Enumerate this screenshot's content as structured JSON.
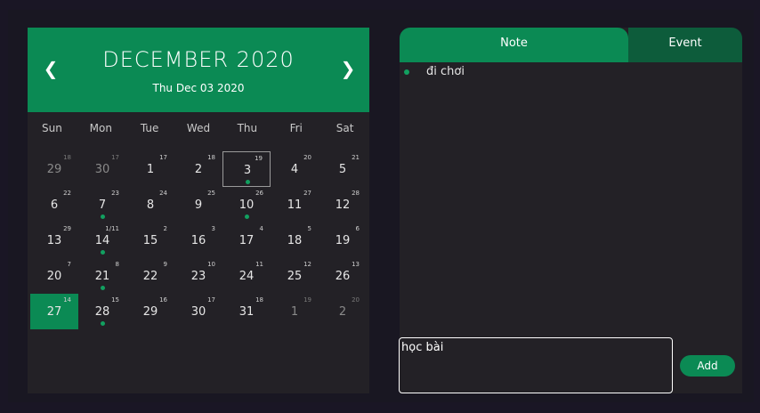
{
  "calendar": {
    "title": "DECEMBER 2020",
    "selected_date_label": "Thu Dec 03 2020",
    "prev_icon": "chevron-left",
    "next_icon": "chevron-right",
    "weekdays": [
      "Sun",
      "Mon",
      "Tue",
      "Wed",
      "Thu",
      "Fri",
      "Sat"
    ],
    "days": [
      {
        "day": "29",
        "lunar": "18",
        "other": true
      },
      {
        "day": "30",
        "lunar": "17",
        "other": true
      },
      {
        "day": "1",
        "lunar": "17"
      },
      {
        "day": "2",
        "lunar": "18"
      },
      {
        "day": "3",
        "lunar": "19",
        "dot": true,
        "selected": true
      },
      {
        "day": "4",
        "lunar": "20"
      },
      {
        "day": "5",
        "lunar": "21"
      },
      {
        "day": "6",
        "lunar": "22"
      },
      {
        "day": "7",
        "lunar": "23",
        "dot": true
      },
      {
        "day": "8",
        "lunar": "24"
      },
      {
        "day": "9",
        "lunar": "25"
      },
      {
        "day": "10",
        "lunar": "26",
        "dot": true
      },
      {
        "day": "11",
        "lunar": "27"
      },
      {
        "day": "12",
        "lunar": "28"
      },
      {
        "day": "13",
        "lunar": "29"
      },
      {
        "day": "14",
        "lunar": "1/11",
        "dot": true
      },
      {
        "day": "15",
        "lunar": "2"
      },
      {
        "day": "16",
        "lunar": "3"
      },
      {
        "day": "17",
        "lunar": "4"
      },
      {
        "day": "18",
        "lunar": "5"
      },
      {
        "day": "19",
        "lunar": "6"
      },
      {
        "day": "20",
        "lunar": "7"
      },
      {
        "day": "21",
        "lunar": "8",
        "dot": true
      },
      {
        "day": "22",
        "lunar": "9"
      },
      {
        "day": "23",
        "lunar": "10"
      },
      {
        "day": "24",
        "lunar": "11"
      },
      {
        "day": "25",
        "lunar": "12"
      },
      {
        "day": "26",
        "lunar": "13"
      },
      {
        "day": "27",
        "lunar": "14",
        "today": true
      },
      {
        "day": "28",
        "lunar": "15",
        "dot": true
      },
      {
        "day": "29",
        "lunar": "16"
      },
      {
        "day": "30",
        "lunar": "17"
      },
      {
        "day": "31",
        "lunar": "18"
      },
      {
        "day": "1",
        "lunar": "19",
        "other": true
      },
      {
        "day": "2",
        "lunar": "20",
        "other": true
      }
    ]
  },
  "panel": {
    "tabs": [
      "Note",
      "Event"
    ],
    "active_tab": "Note",
    "notes": [
      "đi chơi"
    ],
    "input_value": "học bài",
    "add_label": "Add"
  },
  "colors": {
    "accent": "#0b8a54",
    "accent_dark": "#0d5c3b",
    "dot": "#12a060",
    "panel_bg": "#232126",
    "page_bg": "#1a1625"
  }
}
